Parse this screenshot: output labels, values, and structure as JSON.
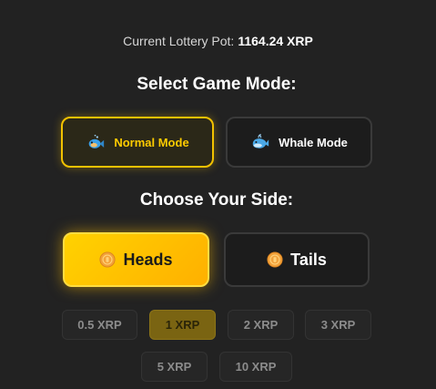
{
  "pot": {
    "label": "Current Lottery Pot:",
    "value": "1164.24 XRP"
  },
  "game_mode": {
    "heading": "Select Game Mode:",
    "options": [
      {
        "label": "Normal Mode",
        "icon": "fish-icon",
        "selected": true
      },
      {
        "label": "Whale Mode",
        "icon": "whale-icon",
        "selected": false
      }
    ]
  },
  "side": {
    "heading": "Choose Your Side:",
    "options": [
      {
        "label": "Heads",
        "icon": "coin-icon",
        "selected": true
      },
      {
        "label": "Tails",
        "icon": "coin-icon",
        "selected": false
      }
    ]
  },
  "bet_amounts": {
    "options": [
      {
        "label": "0.5 XRP",
        "selected": false
      },
      {
        "label": "1 XRP",
        "selected": true
      },
      {
        "label": "2 XRP",
        "selected": false
      },
      {
        "label": "3 XRP",
        "selected": false
      },
      {
        "label": "5 XRP",
        "selected": false
      },
      {
        "label": "10 XRP",
        "selected": false
      }
    ]
  },
  "colors": {
    "background": "#222222",
    "accent": "#ffcc00",
    "selected_amount": "#7a6412"
  }
}
